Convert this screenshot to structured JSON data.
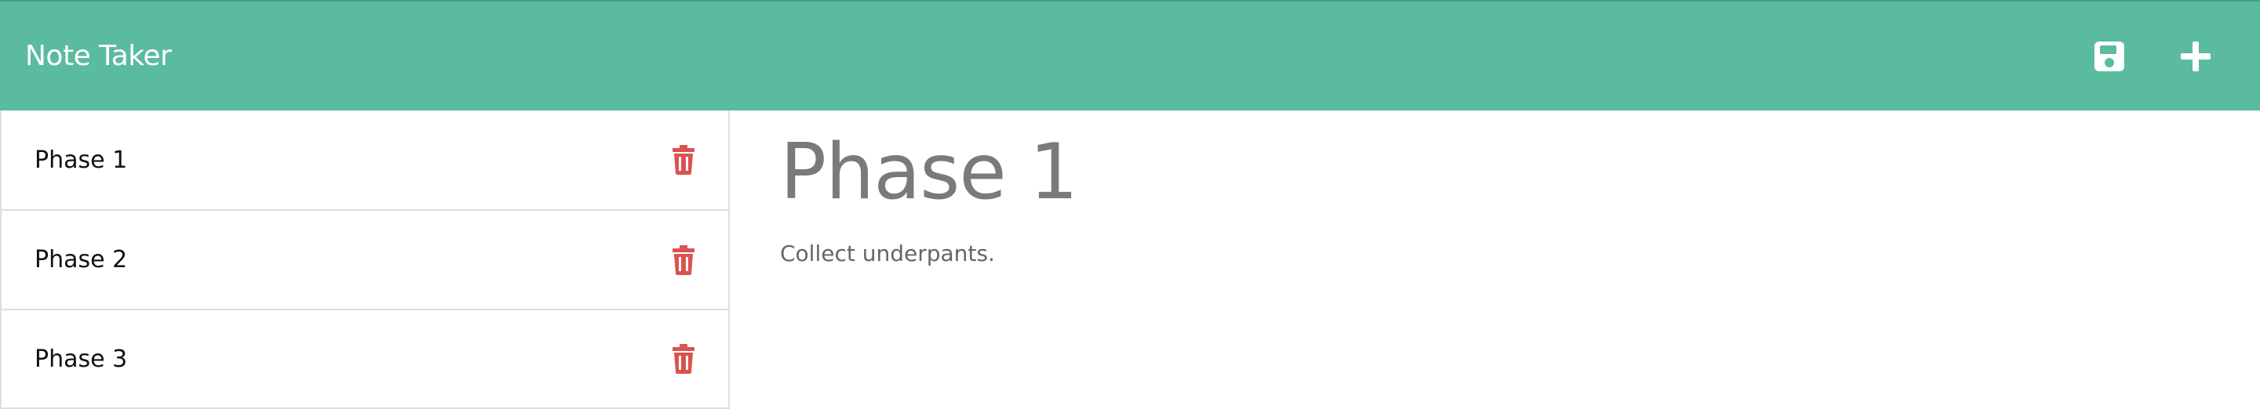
{
  "app": {
    "title": "Note Taker"
  },
  "navbar": {
    "icons": [
      "save-icon",
      "plus-icon"
    ]
  },
  "notes": [
    {
      "title": "Phase 1",
      "action_icon": "trash-icon"
    },
    {
      "title": "Phase 2",
      "action_icon": "trash-icon"
    },
    {
      "title": "Phase 3",
      "action_icon": "trash-icon"
    }
  ],
  "active_note": {
    "title": "Phase 1",
    "text": "Collect underpants."
  },
  "colors": {
    "navbar": "#5bbb9f",
    "delete": "#d9534f",
    "heading": "#7a7a7a"
  }
}
